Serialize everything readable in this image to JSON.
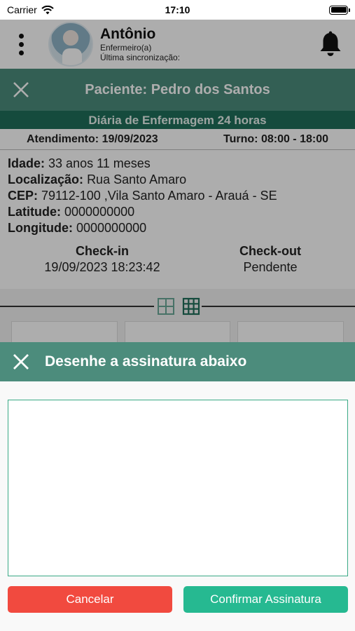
{
  "status_bar": {
    "carrier": "Carrier",
    "time": "17:10"
  },
  "header": {
    "user_name": "Antônio",
    "user_role": "Enfermeiro(a)",
    "sync_label": "Última sincronização:"
  },
  "patient": {
    "title": "Paciente: Pedro dos Santos",
    "service": "Diária de Enfermagem 24 horas",
    "attendance_label": "Atendimento:",
    "attendance_date": "19/09/2023",
    "shift_label": "Turno:",
    "shift_value": "08:00 - 18:00"
  },
  "details": {
    "age_label": "Idade:",
    "age_value": "33 anos 11 meses",
    "location_label": "Localização:",
    "location_value": "Rua Santo Amaro",
    "cep_label": "CEP:",
    "cep_value": "79112-100 ,Vila Santo Amaro - Arauá - SE",
    "lat_label": "Latitude:",
    "lat_value": "0000000000",
    "lon_label": "Longitude:",
    "lon_value": "0000000000"
  },
  "check": {
    "in_label": "Check-in",
    "in_value": "19/09/2023 18:23:42",
    "out_label": "Check-out",
    "out_value": "Pendente"
  },
  "signature": {
    "title": "Desenhe a assinatura abaixo",
    "cancel_label": "Cancelar",
    "confirm_label": "Confirmar Assinatura"
  },
  "colors": {
    "header_green": "#4c8c7c",
    "dark_green": "#1f6f5b",
    "cancel_red": "#f14a3f",
    "confirm_green": "#26b991"
  },
  "icons": [
    "wifi-icon",
    "battery-icon",
    "menu-dots-icon",
    "bell-icon",
    "close-icon",
    "grid-2x2-icon",
    "grid-3x3-icon"
  ]
}
